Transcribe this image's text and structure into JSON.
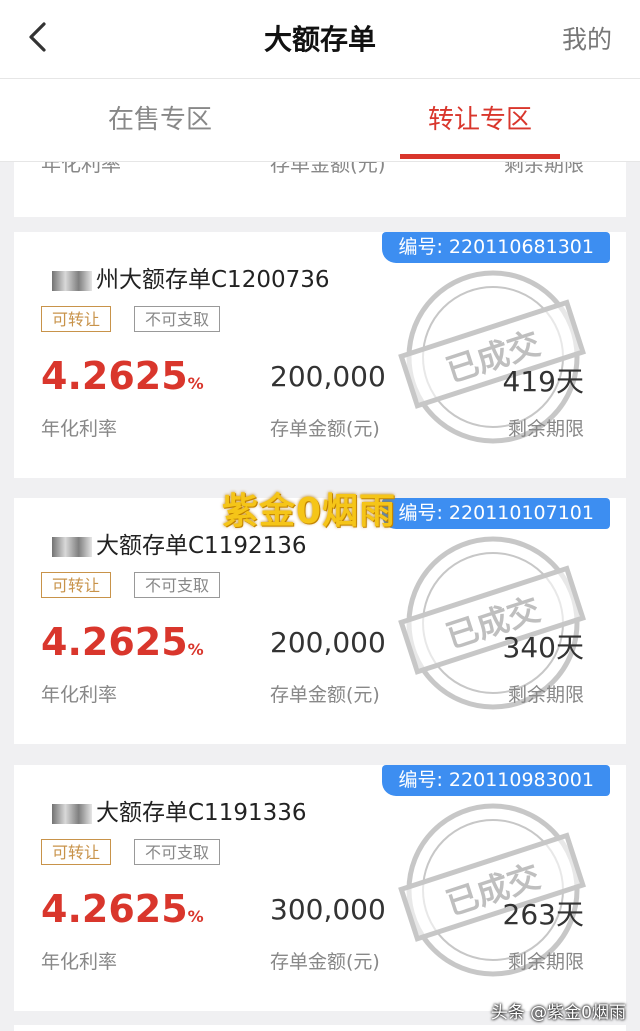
{
  "header": {
    "title": "大额存单",
    "right_link": "我的"
  },
  "tabs": [
    {
      "label": "在售专区",
      "active": false
    },
    {
      "label": "转让专区",
      "active": true
    }
  ],
  "partial_card": {
    "labels": [
      "年化利率",
      "存单金额(元)",
      "剩余期限"
    ]
  },
  "cards": [
    {
      "serial": "编号: 220110681301",
      "name": "州大额存单C1200736",
      "tags": [
        "可转让",
        "不可支取"
      ],
      "rate": "4.2625",
      "rate_unit": "%",
      "amount": "200,000",
      "term": "419天",
      "labels": [
        "年化利率",
        "存单金额(元)",
        "剩余期限"
      ],
      "stamp": "已成交"
    },
    {
      "serial": "编号: 220110107101",
      "name": "大额存单C1192136",
      "tags": [
        "可转让",
        "不可支取"
      ],
      "rate": "4.2625",
      "rate_unit": "%",
      "amount": "200,000",
      "term": "340天",
      "labels": [
        "年化利率",
        "存单金额(元)",
        "剩余期限"
      ],
      "stamp": "已成交"
    },
    {
      "serial": "编号: 220110983001",
      "name": "大额存单C1191336",
      "tags": [
        "可转让",
        "不可支取"
      ],
      "rate": "4.2625",
      "rate_unit": "%",
      "amount": "300,000",
      "term": "263天",
      "labels": [
        "年化利率",
        "存单金额(元)",
        "剩余期限"
      ],
      "stamp": "已成交"
    }
  ],
  "watermark": "紫金0烟雨",
  "footer_watermark": "头条 @紫金0烟雨",
  "colors": {
    "accent": "#d9362c",
    "badge": "#3d8ef1",
    "tag_transfer": "#c8934a"
  }
}
